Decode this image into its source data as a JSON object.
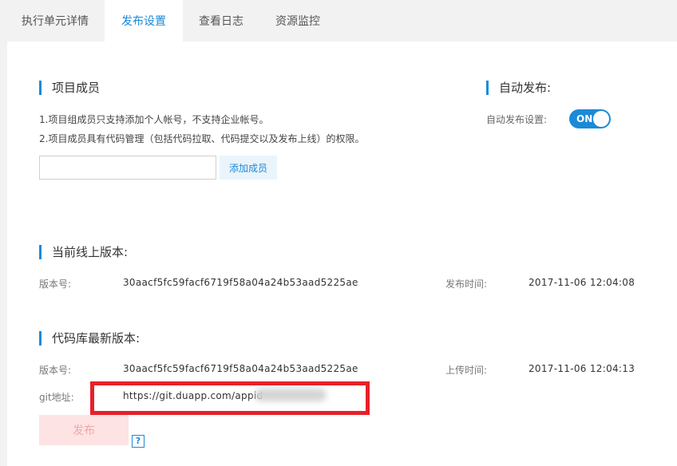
{
  "tabs": [
    {
      "label": "执行单元详情"
    },
    {
      "label": "发布设置",
      "active": true
    },
    {
      "label": "查看日志"
    },
    {
      "label": "资源监控"
    }
  ],
  "members": {
    "title": "项目成员",
    "note1": "1.项目组成员只支持添加个人帐号，不支持企业帐号。",
    "note2": "2.项目成员具有代码管理（包括代码拉取、代码提交以及发布上线）的权限。",
    "input_value": "",
    "add_label": "添加成员"
  },
  "auto_publish": {
    "title": "自动发布:",
    "setting_label": "自动发布设置:",
    "toggle_state": "ON"
  },
  "online_version": {
    "title": "当前线上版本:",
    "version_label": "版本号:",
    "version_value": "30aacf5fc59facf6719f58a04a24b53aad5225ae",
    "time_label": "发布时间:",
    "time_value": "2017-11-06 12:04:08"
  },
  "repo_version": {
    "title": "代码库最新版本:",
    "version_label": "版本号:",
    "version_value": "30aacf5fc59facf6719f58a04a24b53aad5225ae",
    "time_label": "上传时间:",
    "time_value": "2017-11-06 12:04:13",
    "git_label": "git地址:",
    "git_value": "https://git.duapp.com/appid"
  },
  "publish": {
    "label": "发布",
    "help": "?"
  },
  "colors": {
    "accent": "#1a8ad8",
    "highlight_box": "#e8202a",
    "publish_disabled_bg": "#fde3e3"
  }
}
